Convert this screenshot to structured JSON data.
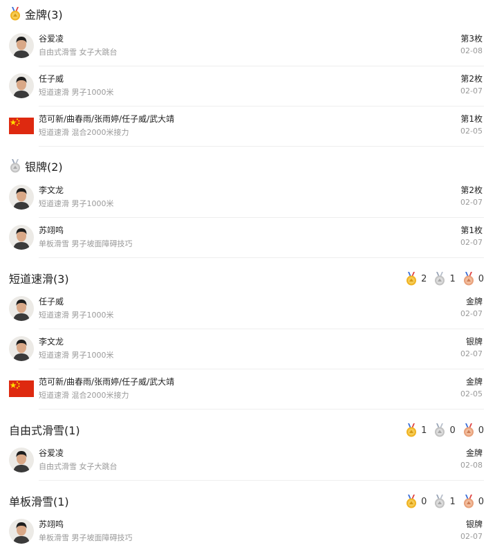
{
  "colors": {
    "gold": "#f0b323",
    "silver": "#c2c2c2",
    "bronze": "#e8a07a",
    "flag_red": "#de2910",
    "flag_yellow": "#ffde00"
  },
  "gold_section": {
    "title": "金牌(3)",
    "icon": "gold-medal-icon",
    "items": [
      {
        "name": "谷爱凌",
        "event": "自由式滑雪 女子大跳台",
        "rank": "第3枚",
        "date": "02-08",
        "avatar": "athlete-avatar"
      },
      {
        "name": "任子威",
        "event": "短道速滑 男子1000米",
        "rank": "第2枚",
        "date": "02-07",
        "avatar": "athlete-avatar"
      },
      {
        "name": "范可新/曲春雨/张雨婷/任子威/武大靖",
        "event": "短道速滑 混合2000米接力",
        "rank": "第1枚",
        "date": "02-05",
        "avatar": "china-flag-icon"
      }
    ]
  },
  "silver_section": {
    "title": "银牌(2)",
    "icon": "silver-medal-icon",
    "items": [
      {
        "name": "李文龙",
        "event": "短道速滑 男子1000米",
        "rank": "第2枚",
        "date": "02-07",
        "avatar": "athlete-avatar"
      },
      {
        "name": "苏翊鸣",
        "event": "单板滑雪 男子坡面障碍技巧",
        "rank": "第1枚",
        "date": "02-07",
        "avatar": "athlete-avatar"
      }
    ]
  },
  "short_track_section": {
    "title": "短道速滑(3)",
    "tally": {
      "gold": "2",
      "silver": "1",
      "bronze": "0"
    },
    "items": [
      {
        "name": "任子威",
        "event": "短道速滑 男子1000米",
        "medal": "金牌",
        "date": "02-07",
        "avatar": "athlete-avatar"
      },
      {
        "name": "李文龙",
        "event": "短道速滑 男子1000米",
        "medal": "银牌",
        "date": "02-07",
        "avatar": "athlete-avatar"
      },
      {
        "name": "范可新/曲春雨/张雨婷/任子威/武大靖",
        "event": "短道速滑 混合2000米接力",
        "medal": "金牌",
        "date": "02-05",
        "avatar": "china-flag-icon"
      }
    ]
  },
  "freestyle_section": {
    "title": "自由式滑雪(1)",
    "tally": {
      "gold": "1",
      "silver": "0",
      "bronze": "0"
    },
    "items": [
      {
        "name": "谷爱凌",
        "event": "自由式滑雪 女子大跳台",
        "medal": "金牌",
        "date": "02-08",
        "avatar": "athlete-avatar"
      }
    ]
  },
  "snowboard_section": {
    "title": "单板滑雪(1)",
    "tally": {
      "gold": "0",
      "silver": "1",
      "bronze": "0"
    },
    "items": [
      {
        "name": "苏翊鸣",
        "event": "单板滑雪 男子坡面障碍技巧",
        "medal": "银牌",
        "date": "02-07",
        "avatar": "athlete-avatar"
      }
    ]
  }
}
